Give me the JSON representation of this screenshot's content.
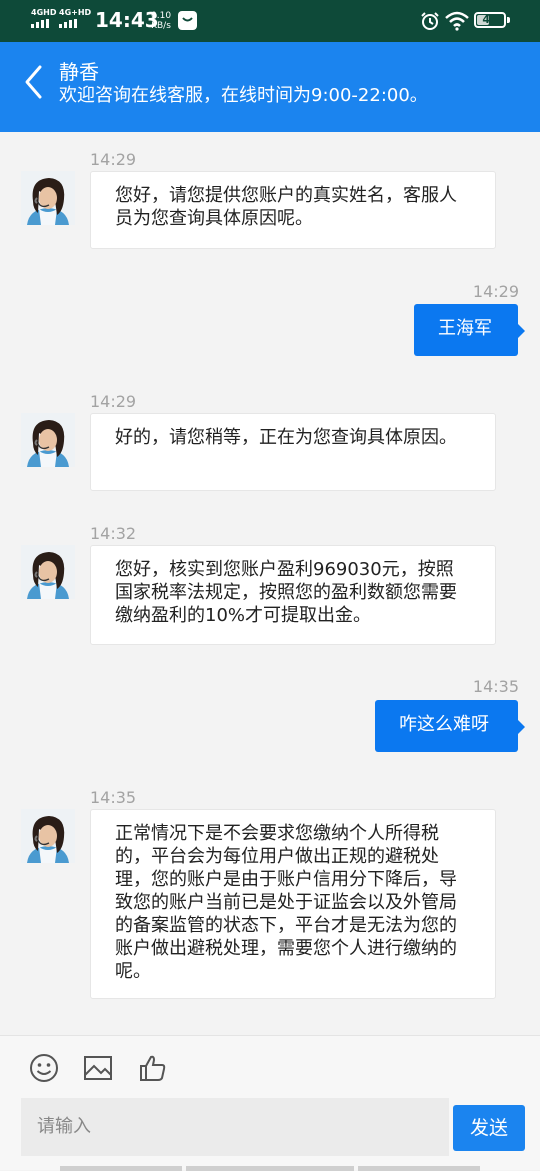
{
  "status_bar": {
    "net1": "4GHD",
    "net2": "4G+HD",
    "time": "14:43",
    "speed_value": "0.10",
    "speed_unit": "KB/s",
    "battery": "47",
    "battery_level": 0.47
  },
  "header": {
    "title": "静香",
    "subtitle": "欢迎咨询在线客服，在线时间为9:00-22:00。"
  },
  "messages": [
    {
      "time": "14:29",
      "side": "in",
      "text": "您好，请您提供您账户的真实姓名，客服人员为您查询具体原因呢。"
    },
    {
      "time": "14:29",
      "side": "out",
      "text": "王海军"
    },
    {
      "time": "14:29",
      "side": "in",
      "text": "好的，请您稍等，正在为您查询具体原因。"
    },
    {
      "time": "14:32",
      "side": "in",
      "text": "您好，核实到您账户盈利969030元，按照国家税率法规定，按照您的盈利数额您需要缴纳盈利的10%才可提取出金。"
    },
    {
      "time": "14:35",
      "side": "out",
      "text": "咋这么难呀"
    },
    {
      "time": "14:35",
      "side": "in",
      "text": "正常情况下是不会要求您缴纳个人所得税的，平台会为每位用户做出正规的避税处理，您的账户是由于账户信用分下降后，导致您的账户当前已是处于证监会以及外管局的备案监管的状态下，平台才是无法为您的账户做出避税处理，需要您个人进行缴纳的呢。"
    }
  ],
  "composer": {
    "placeholder": "请输入",
    "send_label": "发送",
    "tools": [
      "emoji-icon",
      "image-icon",
      "thumbs-up-icon"
    ]
  },
  "colors": {
    "status_bar": "#0e4a39",
    "header": "#1b84ef",
    "out_bubble": "#0b78f0",
    "background": "#f3f3f3"
  }
}
